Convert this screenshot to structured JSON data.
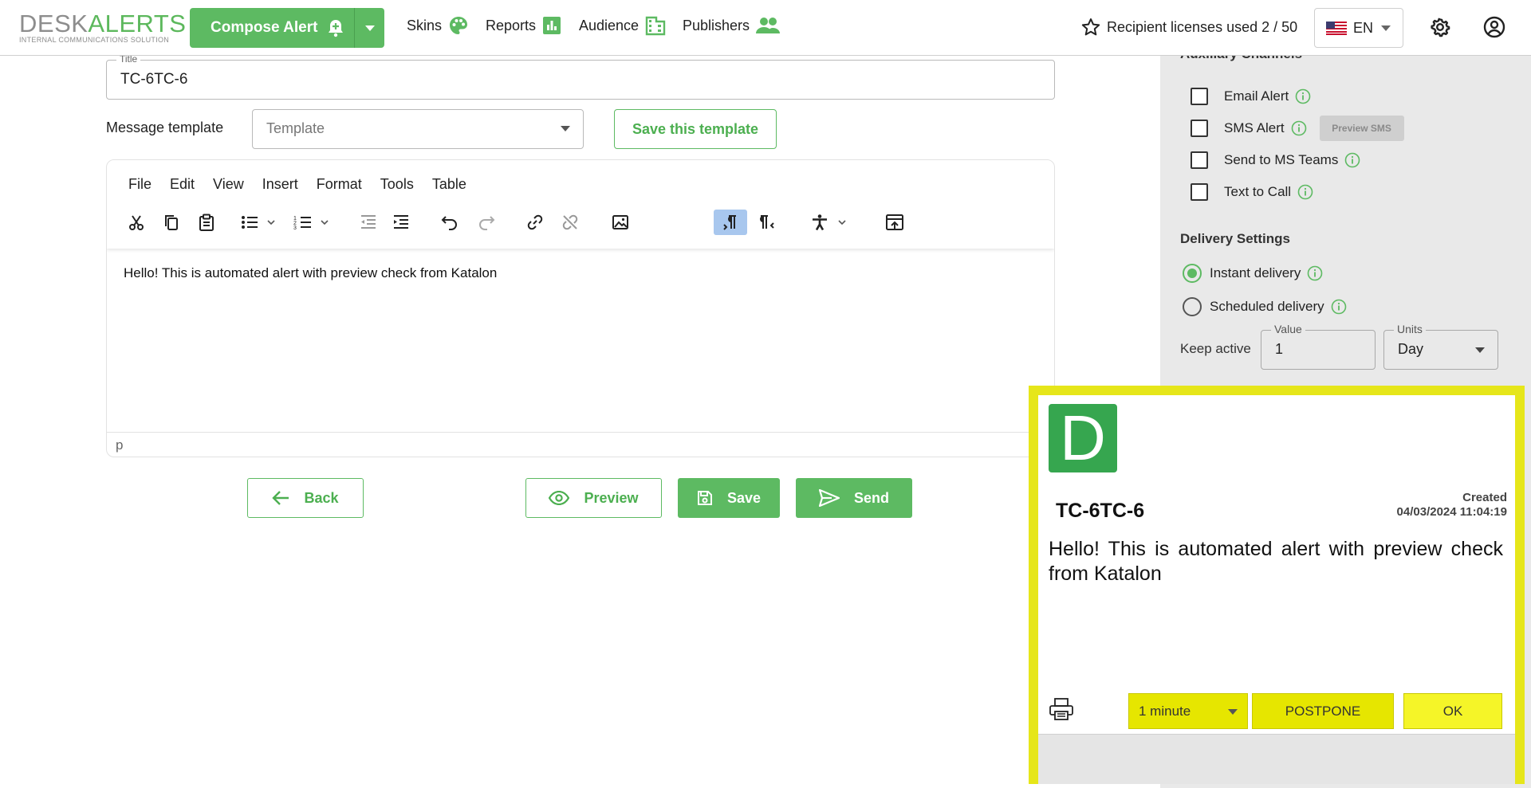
{
  "brand": {
    "logo_part1": "DESK",
    "logo_part2": "ALERTS",
    "tagline": "INTERNAL COMMUNICATIONS SOLUTION"
  },
  "header": {
    "compose_label": "Compose Alert",
    "nav": [
      {
        "label": "Skins",
        "icon": "palette-icon"
      },
      {
        "label": "Reports",
        "icon": "bar-chart-icon"
      },
      {
        "label": "Audience",
        "icon": "building-icon"
      },
      {
        "label": "Publishers",
        "icon": "people-icon"
      }
    ],
    "licenses": "Recipient licenses used 2 / 50",
    "language": "EN"
  },
  "form": {
    "title_label": "Title",
    "title_value": "TC-6TC-6",
    "template_label": "Message template",
    "template_placeholder": "Template",
    "save_template_label": "Save this template"
  },
  "editor": {
    "menus": [
      "File",
      "Edit",
      "View",
      "Insert",
      "Format",
      "Tools",
      "Table"
    ],
    "content": "Hello! This is automated alert with preview check from Katalon",
    "status_path": "p"
  },
  "actions": {
    "back": "Back",
    "preview": "Preview",
    "save": "Save",
    "send": "Send"
  },
  "side": {
    "aux_heading": "Auxiliary Channels",
    "channels": [
      {
        "label": "Email Alert",
        "checked": false
      },
      {
        "label": "SMS Alert",
        "checked": false
      },
      {
        "label": "Send to MS Teams",
        "checked": false
      },
      {
        "label": "Text to Call",
        "checked": false
      }
    ],
    "preview_sms": "Preview SMS",
    "delivery_heading": "Delivery Settings",
    "instant_label": "Instant delivery",
    "scheduled_label": "Scheduled delivery",
    "selected_delivery": "Instant delivery",
    "keep_active_label": "Keep active",
    "value_label": "Value",
    "value": "1",
    "units_label": "Units",
    "units_value": "Day"
  },
  "popup": {
    "logo_letter": "D",
    "title": "TC-6TC-6",
    "created_label": "Created",
    "created_date": "04/03/2024 11:04:19",
    "body": "Hello! This is automated alert with preview check from Katalon",
    "postpone_option": "1 minute",
    "postpone_label": "POSTPONE",
    "ok_label": "OK",
    "border_color": "#e6e61a"
  },
  "colors": {
    "accent": "#5dba62",
    "popup_yellow": "#e6e600",
    "panel_bg": "#e9e9e9"
  }
}
